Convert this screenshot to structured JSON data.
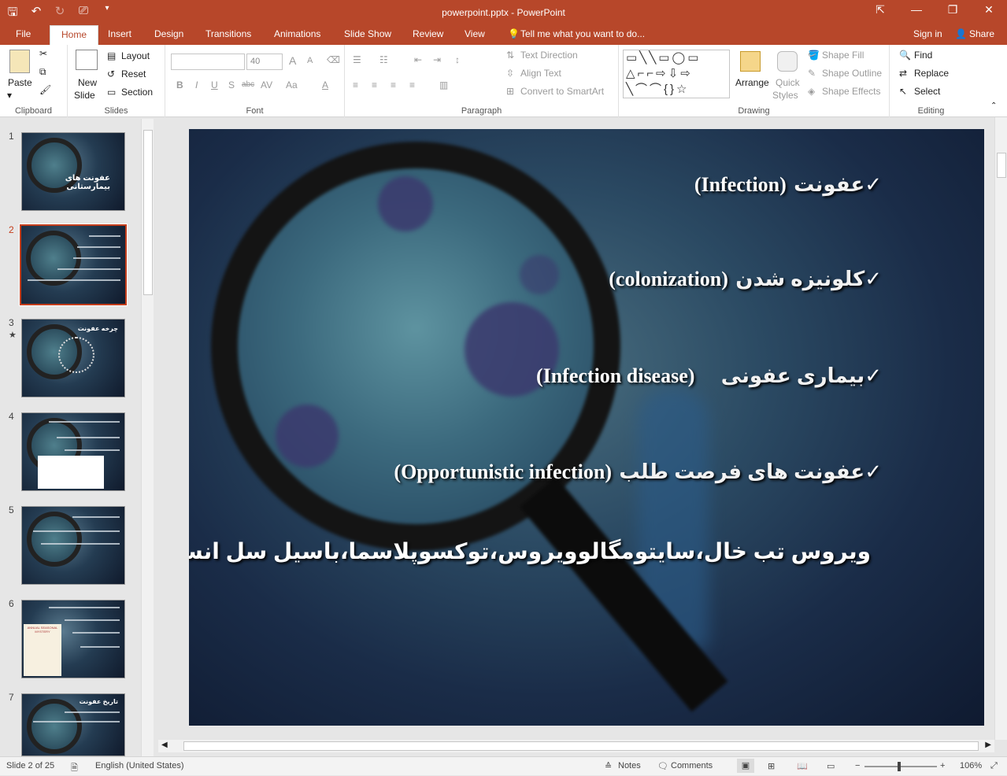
{
  "app": {
    "doc_title": "powerpoint.pptx - PowerPoint",
    "qat": {
      "save_icon": "save-icon",
      "undo_icon": "undo-icon",
      "redo_icon": "redo-icon",
      "present_icon": "present-icon",
      "customize_icon": "chevron-down-icon"
    },
    "window": {
      "restore_label": "⇱",
      "minimize_label": "—",
      "maximize_label": "❐",
      "close_label": "✕"
    }
  },
  "tabs": {
    "file": "File",
    "home": "Home",
    "insert": "Insert",
    "design": "Design",
    "transitions": "Transitions",
    "animations": "Animations",
    "slide_show": "Slide Show",
    "review": "Review",
    "view": "View",
    "tell_me": "Tell me what you want to do...",
    "sign_in": "Sign in",
    "share": "Share"
  },
  "ribbon": {
    "clipboard": {
      "label": "Clipboard",
      "paste": "Paste"
    },
    "slides": {
      "label": "Slides",
      "new_slide_1": "New",
      "new_slide_2": "Slide",
      "layout": "Layout",
      "reset": "Reset",
      "section": "Section"
    },
    "font": {
      "label": "Font",
      "size": "40",
      "bold": "B",
      "italic": "I",
      "underline": "U",
      "shadow": "S",
      "strike": "abc",
      "spacing": "AV",
      "case": "Aa",
      "color": "A",
      "grow": "A",
      "shrink": "A"
    },
    "paragraph": {
      "label": "Paragraph",
      "text_direction": "Text Direction",
      "align_text": "Align Text",
      "convert_smartart": "Convert to SmartArt"
    },
    "drawing": {
      "label": "Drawing",
      "arrange": "Arrange",
      "quick_styles_1": "Quick",
      "quick_styles_2": "Styles",
      "shape_fill": "Shape Fill",
      "shape_outline": "Shape Outline",
      "shape_effects": "Shape Effects"
    },
    "editing": {
      "label": "Editing",
      "find": "Find",
      "replace": "Replace",
      "select": "Select"
    }
  },
  "thumbnails": {
    "numbers": [
      "1",
      "2",
      "3",
      "4",
      "5",
      "6",
      "7"
    ],
    "slide1_title": "عفونت های بیمارستانی",
    "slide3_title": "چرخه عفونت",
    "slide6_art_label": "ANNUAL SEASONAL MYSTERY",
    "slide7_title": "تاریخ عفونت"
  },
  "slide": {
    "bullets": [
      {
        "fa": "عفونت",
        "en": "(Infection)"
      },
      {
        "fa": "کلونیزه شدن",
        "en": "(colonization)"
      },
      {
        "fa": "بیماری عفونی",
        "en": "(Infection disease)"
      },
      {
        "fa": "عفونت های فرصت طلب",
        "en": "(Opportunistic infection)"
      }
    ],
    "check_mark": "✓",
    "examples": "ویروس تب خال،سایتومگالوویروس،توکسوپلاسما،باسیل سل انسانی"
  },
  "status": {
    "slide_info": "Slide 2 of 25",
    "language": "English (United States)",
    "notes": "Notes",
    "comments": "Comments",
    "zoom": "106%"
  }
}
